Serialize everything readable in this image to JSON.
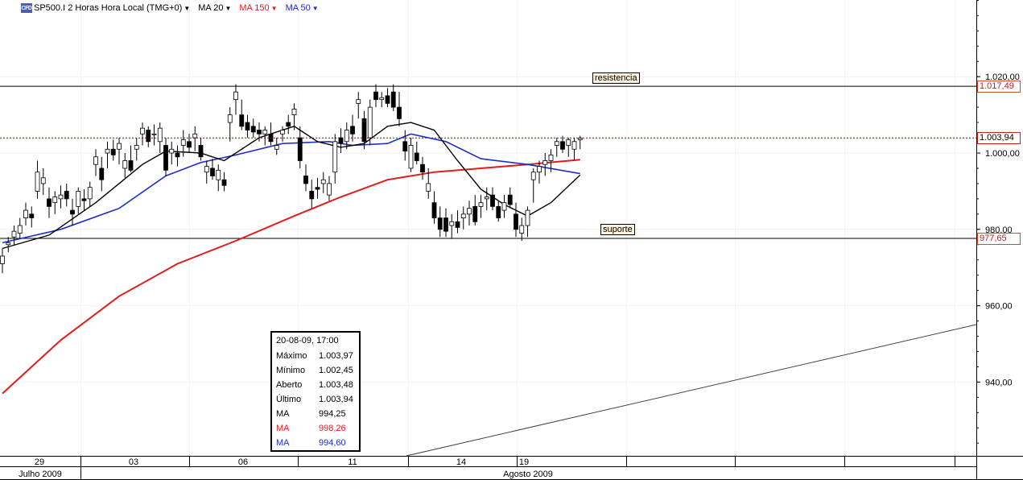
{
  "header": {
    "symbol": "SP500.I 2 Horas Hora Local (TMG+0)",
    "ma20": "MA 20",
    "ma150": "MA 150",
    "ma50": "MA 50",
    "logo": "CFD"
  },
  "annotations": {
    "resistance_label": "resistencia",
    "support_label": "suporte",
    "resistance_price": "1.017,49",
    "last_price": "1.003,94",
    "support_price": "977,65"
  },
  "colors": {
    "ma20": "#000000",
    "ma150": "#e21b1b",
    "ma50": "#1e2ec9",
    "candle_up": "#ffffff",
    "candle_down": "#000000"
  },
  "info_box": {
    "date": "20-08-09, 17:00",
    "rows": [
      {
        "label": "Máximo",
        "value": "1.003,97",
        "color": "black"
      },
      {
        "label": "Mínimo",
        "value": "1.002,45",
        "color": "black"
      },
      {
        "label": "Aberto",
        "value": "1.003,48",
        "color": "black"
      },
      {
        "label": "Último",
        "value": "1.003,94",
        "color": "black"
      },
      {
        "label": "MA",
        "value": "994,25",
        "color": "black"
      },
      {
        "label": "MA",
        "value": "998,26",
        "color": "red"
      },
      {
        "label": "MA",
        "value": "994,60",
        "color": "blue"
      }
    ]
  },
  "chart_data": {
    "type": "candlestick",
    "y_ticks": [
      "1.020,00",
      "1.000,00",
      "980,00",
      "960,00",
      "940,00"
    ],
    "y_tick_values": [
      1020,
      1000,
      980,
      960,
      940
    ],
    "ylim": [
      920,
      1040
    ],
    "x_day_labels": [
      "29",
      "03",
      "06",
      "11",
      "14",
      "19"
    ],
    "x_month_labels": [
      "Julho 2009",
      "Agosto 2009"
    ],
    "resistance": 1017.49,
    "support": 977.65,
    "last": 1003.94,
    "candles": [
      [
        971.0,
        975.0,
        968.5,
        973.0
      ],
      [
        976.0,
        978.0,
        974.0,
        976.5
      ],
      [
        978.0,
        981.0,
        976.0,
        979.5
      ],
      [
        979.0,
        983.0,
        977.5,
        981.0
      ],
      [
        983.0,
        987.0,
        981.0,
        985.0
      ],
      [
        984.0,
        986.0,
        980.5,
        983.0
      ],
      [
        990.0,
        998.0,
        988.0,
        995.0
      ],
      [
        992.0,
        996.0,
        989.0,
        993.5
      ],
      [
        988.0,
        991.0,
        983.0,
        986.0
      ],
      [
        987.0,
        990.0,
        984.0,
        988.5
      ],
      [
        988.0,
        991.5,
        985.5,
        989.0
      ],
      [
        990.0,
        992.0,
        986.0,
        988.0
      ],
      [
        985.0,
        988.0,
        981.0,
        984.0
      ],
      [
        986.0,
        991.0,
        984.0,
        990.0
      ],
      [
        988.0,
        990.5,
        985.0,
        987.5
      ],
      [
        988.0,
        992.5,
        986.0,
        991.0
      ],
      [
        997.0,
        1001.0,
        994.0,
        999.0
      ],
      [
        996.0,
        999.0,
        990.0,
        993.0
      ],
      [
        1000.0,
        1003.0,
        996.0,
        1001.0
      ],
      [
        1001.0,
        1003.5,
        998.0,
        999.5
      ],
      [
        1001.0,
        1004.0,
        997.0,
        1002.5
      ],
      [
        996.0,
        1000.0,
        993.5,
        998.0
      ],
      [
        998.0,
        1002.0,
        995.0,
        995.5
      ],
      [
        1001.0,
        1004.0,
        998.0,
        1002.0
      ],
      [
        1005.0,
        1008.0,
        1002.0,
        1006.5
      ],
      [
        1006.0,
        1007.0,
        1001.5,
        1003.0
      ],
      [
        1005.0,
        1007.5,
        1002.0,
        1005.0
      ],
      [
        1003.0,
        1008.0,
        1000.0,
        1006.5
      ],
      [
        1002.0,
        1004.0,
        994.0,
        995.5
      ],
      [
        1000.0,
        1003.0,
        997.0,
        1001.0
      ],
      [
        1000.0,
        1002.0,
        996.5,
        999.0
      ],
      [
        1002.0,
        1006.0,
        999.0,
        1003.5
      ],
      [
        1003.0,
        1005.0,
        1000.0,
        1001.5
      ],
      [
        1004.0,
        1007.0,
        1000.5,
        1005.0
      ],
      [
        1002.0,
        1004.0,
        998.0,
        999.0
      ],
      [
        995.0,
        998.0,
        992.0,
        996.5
      ],
      [
        996.0,
        998.5,
        993.0,
        994.0
      ],
      [
        993.0,
        997.0,
        990.0,
        995.5
      ],
      [
        993.0,
        995.0,
        990.0,
        991.5
      ],
      [
        1008.0,
        1012.0,
        1003.0,
        1010.0
      ],
      [
        1014.0,
        1018.0,
        1010.0,
        1016.0
      ],
      [
        1010.0,
        1014.0,
        1006.0,
        1007.0
      ],
      [
        1008.0,
        1010.0,
        1004.0,
        1006.0
      ],
      [
        1007.0,
        1009.0,
        1004.0,
        1005.5
      ],
      [
        1006.0,
        1008.0,
        1003.0,
        1005.0
      ],
      [
        1005.0,
        1007.0,
        1002.0,
        1006.0
      ],
      [
        1005.0,
        1008.0,
        1002.0,
        1003.0
      ],
      [
        1001.0,
        1004.0,
        999.5,
        1002.0
      ],
      [
        1005.0,
        1007.0,
        1003.0,
        1006.0
      ],
      [
        1008.0,
        1010.0,
        1005.0,
        1007.0
      ],
      [
        1010.0,
        1013.0,
        1006.0,
        1011.5
      ],
      [
        1004.0,
        1007.0,
        996.0,
        998.0
      ],
      [
        994.0,
        997.0,
        990.0,
        992.0
      ],
      [
        990.0,
        993.0,
        985.5,
        988.0
      ],
      [
        991.0,
        993.5,
        988.0,
        990.5
      ],
      [
        992.0,
        995.0,
        989.5,
        993.0
      ],
      [
        989.0,
        994.0,
        987.5,
        992.0
      ],
      [
        995.0,
        1005.0,
        992.0,
        1003.0
      ],
      [
        1004.0,
        1006.5,
        1000.0,
        1002.5
      ],
      [
        1003.0,
        1008.0,
        1001.0,
        1006.0
      ],
      [
        1007.0,
        1010.0,
        1003.0,
        1005.0
      ],
      [
        1013.0,
        1016.0,
        1009.0,
        1014.0
      ],
      [
        1009.0,
        1011.0,
        1001.0,
        1003.0
      ],
      [
        1004.0,
        1014.0,
        1002.0,
        1012.0
      ],
      [
        1016.0,
        1018.0,
        1012.0,
        1014.0
      ],
      [
        1014.0,
        1016.0,
        1012.0,
        1014.5
      ],
      [
        1015.0,
        1017.0,
        1012.0,
        1013.0
      ],
      [
        1016.0,
        1018.0,
        1011.0,
        1012.0
      ],
      [
        1012.0,
        1016.0,
        1007.0,
        1009.0
      ],
      [
        1003.0,
        1006.0,
        998.0,
        1000.5
      ],
      [
        996.0,
        1004.0,
        995.0,
        1002.0
      ],
      [
        1000.0,
        1003.0,
        997.0,
        998.0
      ],
      [
        997.0,
        999.0,
        993.0,
        995.0
      ],
      [
        990.0,
        996.0,
        988.0,
        992.0
      ],
      [
        987.0,
        990.0,
        981.5,
        983.0
      ],
      [
        983.0,
        986.0,
        978.0,
        980.0
      ],
      [
        983.0,
        985.5,
        978.0,
        979.5
      ],
      [
        981.0,
        984.0,
        977.5,
        982.0
      ],
      [
        982.0,
        985.0,
        979.0,
        980.5
      ],
      [
        983.0,
        986.0,
        980.0,
        984.0
      ],
      [
        984.0,
        987.5,
        981.0,
        985.5
      ],
      [
        986.0,
        989.0,
        981.0,
        982.0
      ],
      [
        986.0,
        989.0,
        983.0,
        987.0
      ],
      [
        988.0,
        991.0,
        985.0,
        988.5
      ],
      [
        989.0,
        991.0,
        985.0,
        986.0
      ],
      [
        986.0,
        987.5,
        982.0,
        983.0
      ],
      [
        985.0,
        989.0,
        983.0,
        987.0
      ],
      [
        989.0,
        991.0,
        985.5,
        986.5
      ],
      [
        984.0,
        987.0,
        978.0,
        980.0
      ],
      [
        979.0,
        983.0,
        977.0,
        981.0
      ],
      [
        981.0,
        986.0,
        978.0,
        985.0
      ],
      [
        993.0,
        996.0,
        987.0,
        995.0
      ],
      [
        995.0,
        998.0,
        992.0,
        996.5
      ],
      [
        997.0,
        1000.0,
        994.0,
        998.0
      ],
      [
        998.0,
        1001.0,
        995.0,
        999.5
      ],
      [
        1002.0,
        1004.0,
        999.0,
        1003.0
      ],
      [
        1003.0,
        1004.5,
        1000.0,
        1001.0
      ],
      [
        1002.0,
        1004.0,
        999.0,
        1003.5
      ],
      [
        1001.0,
        1004.0,
        998.0,
        1003.0
      ],
      [
        1003.5,
        1004.5,
        1001.0,
        1003.9
      ]
    ],
    "ma20_points": [
      [
        0,
        975.0
      ],
      [
        8,
        978.5
      ],
      [
        16,
        987.0
      ],
      [
        24,
        997.0
      ],
      [
        28,
        1000.5
      ],
      [
        34,
        1000.0
      ],
      [
        38,
        998.0
      ],
      [
        44,
        1004.0
      ],
      [
        50,
        1007.0
      ],
      [
        54,
        1003.0
      ],
      [
        58,
        1001.5
      ],
      [
        62,
        1002.5
      ],
      [
        66,
        1007.0
      ],
      [
        70,
        1008.0
      ],
      [
        74,
        1006.0
      ],
      [
        78,
        998.0
      ],
      [
        82,
        990.5
      ],
      [
        86,
        986.5
      ],
      [
        90,
        983.5
      ],
      [
        94,
        987.0
      ],
      [
        99,
        994.25
      ]
    ],
    "ma50_points": [
      [
        0,
        976.5
      ],
      [
        10,
        980.0
      ],
      [
        20,
        985.5
      ],
      [
        28,
        994.0
      ],
      [
        34,
        997.5
      ],
      [
        40,
        999.5
      ],
      [
        48,
        1002.5
      ],
      [
        56,
        1003.0
      ],
      [
        60,
        1002.0
      ],
      [
        66,
        1002.5
      ],
      [
        70,
        1005.0
      ],
      [
        76,
        1003.0
      ],
      [
        82,
        998.5
      ],
      [
        90,
        997.0
      ],
      [
        99,
        994.6
      ]
    ],
    "ma150_points": [
      [
        0,
        937.0
      ],
      [
        10,
        951.0
      ],
      [
        20,
        962.5
      ],
      [
        30,
        971.0
      ],
      [
        40,
        977.0
      ],
      [
        50,
        983.5
      ],
      [
        58,
        988.5
      ],
      [
        66,
        993.0
      ],
      [
        74,
        995.0
      ],
      [
        82,
        996.0
      ],
      [
        90,
        997.0
      ],
      [
        99,
        998.26
      ]
    ]
  }
}
